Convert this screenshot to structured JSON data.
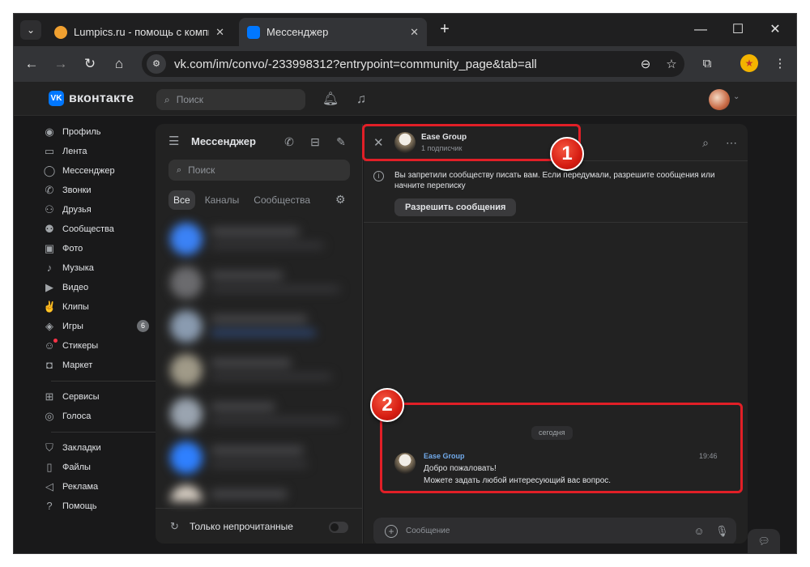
{
  "browser": {
    "tab_search_icon": "chevron-down-icon",
    "tabs": [
      {
        "title": "Lumpics.ru - помощь с компьют",
        "favicon_color": "#f0a030"
      },
      {
        "title": "Мессенджер",
        "favicon_color": "#0077ff"
      }
    ],
    "new_tab": "+",
    "window_controls": [
      "—",
      "☐",
      "✕"
    ],
    "url": "vk.com/im/convo/-233998312?entrypoint=community_page&tab=all"
  },
  "vk": {
    "logo_mark": "VK",
    "logo_text": "вконтакте",
    "search_placeholder": "Поиск",
    "nav_group1": [
      {
        "label": "Профиль",
        "icon": "profile-icon"
      },
      {
        "label": "Лента",
        "icon": "feed-icon"
      },
      {
        "label": "Мессенджер",
        "icon": "messenger-icon"
      },
      {
        "label": "Звонки",
        "icon": "phone-icon"
      },
      {
        "label": "Друзья",
        "icon": "friends-icon"
      },
      {
        "label": "Сообщества",
        "icon": "communities-icon"
      },
      {
        "label": "Фото",
        "icon": "photo-icon"
      },
      {
        "label": "Музыка",
        "icon": "music-icon"
      },
      {
        "label": "Видео",
        "icon": "video-icon"
      },
      {
        "label": "Клипы",
        "icon": "clips-icon"
      },
      {
        "label": "Игры",
        "icon": "games-icon",
        "badge": "6"
      },
      {
        "label": "Стикеры",
        "icon": "stickers-icon"
      },
      {
        "label": "Маркет",
        "icon": "market-icon"
      }
    ],
    "nav_group2": [
      {
        "label": "Сервисы",
        "icon": "services-icon"
      },
      {
        "label": "Голоса",
        "icon": "votes-icon"
      }
    ],
    "nav_group3": [
      {
        "label": "Закладки",
        "icon": "bookmarks-icon"
      },
      {
        "label": "Файлы",
        "icon": "files-icon"
      },
      {
        "label": "Реклама",
        "icon": "ads-icon"
      },
      {
        "label": "Помощь",
        "icon": "help-icon"
      }
    ]
  },
  "messenger": {
    "title": "Мессенджер",
    "search_placeholder": "Поиск",
    "filters": [
      "Все",
      "Каналы",
      "Сообщества"
    ],
    "unread_only_label": "Только непрочитанные"
  },
  "chat": {
    "group_name": "Ease Group",
    "subscribers": "1 подписчик",
    "notice_text": "Вы запретили сообществу писать вам. Если передумали, разрешите сообщения или начните переписку",
    "allow_button": "Разрешить сообщения",
    "date_separator": "сегодня",
    "message": {
      "author": "Ease Group",
      "time": "19:46",
      "line1": "Добро пожаловать!",
      "line2": "Можете задать любой интересующий вас вопрос."
    },
    "composer_placeholder": "Сообщение"
  },
  "annotations": {
    "badge1": "1",
    "badge2": "2",
    "highlight_color": "#e11f27"
  }
}
